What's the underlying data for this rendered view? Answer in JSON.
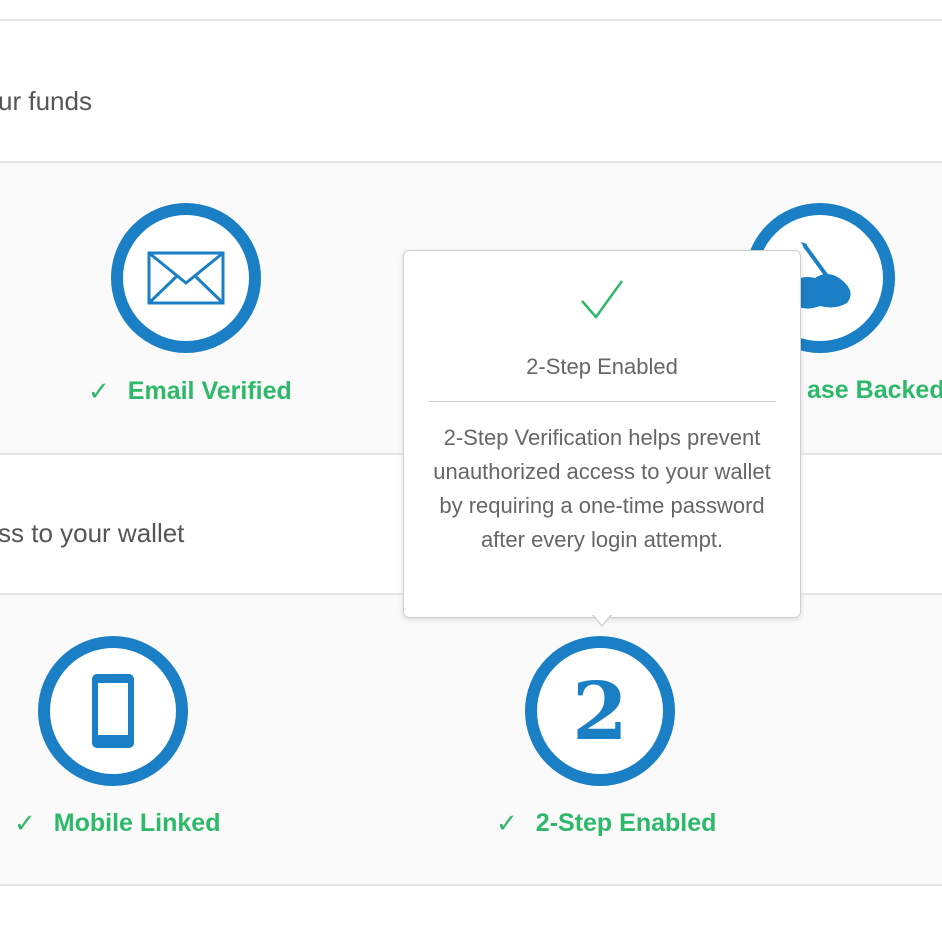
{
  "sections": {
    "funds_text": "ur funds",
    "wallet_text": "ss to your wallet"
  },
  "security_items": {
    "email": {
      "label": "Email Verified",
      "icon": "envelope-icon"
    },
    "phrase": {
      "label": "ase Backed",
      "icon": "hand-writing-icon"
    },
    "mobile": {
      "label": "Mobile Linked",
      "icon": "phone-icon"
    },
    "two_step": {
      "label": "2-Step Enabled",
      "icon_text": "2",
      "icon": "number-two-icon"
    }
  },
  "check_glyph": "✓",
  "tooltip": {
    "title": "2-Step Enabled",
    "body": "2-Step Verification helps prevent unauthorized access to your wallet by requiring a one-time password after every login attempt."
  },
  "colors": {
    "accent_blue": "#1a7fc4",
    "success_green": "#2db86a"
  }
}
